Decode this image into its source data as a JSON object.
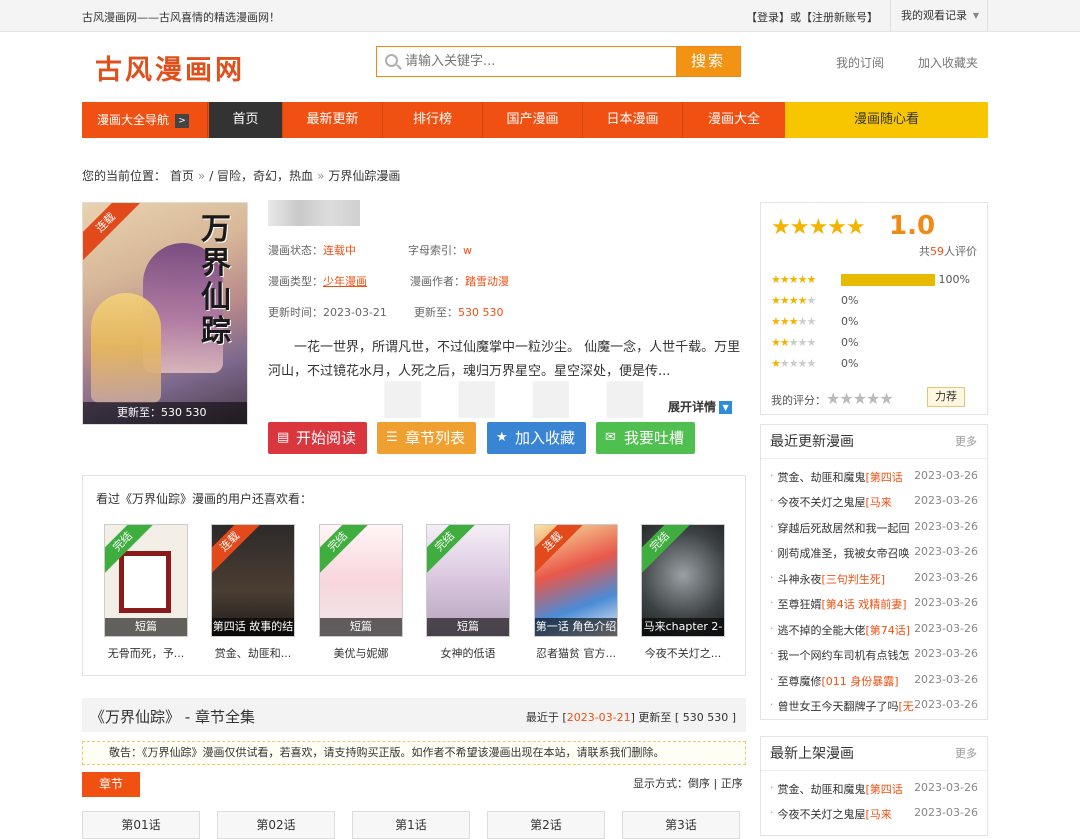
{
  "topbar": {
    "slogan": "古风漫画网——古风喜情的精选漫画网！",
    "login_label": "【登录】或【注册新账号】",
    "history_label": "我的观看记录"
  },
  "header": {
    "logo": "古风漫画网",
    "search_placeholder": "请输入关键字...",
    "search_button": "搜索",
    "link_subscribe": "我的订阅",
    "link_favorite": "加入收藏夹"
  },
  "nav": {
    "guide": "漫画大全导航",
    "items": [
      "首页",
      "最新更新",
      "排行榜",
      "国产漫画",
      "日本漫画",
      "漫画大全"
    ],
    "random": "漫画随心看"
  },
  "breadcrumb": {
    "prefix": "您的当前位置：",
    "home": "首页",
    "tags": "/ 冒险，奇幻，热血",
    "current": "万界仙踪漫画"
  },
  "comic": {
    "cover_title": "万界仙踪",
    "cover_status": "连载",
    "cover_update": "更新至：530 530",
    "status_label": "漫画状态：",
    "status_value": "连载中",
    "index_label": "字母索引：",
    "index_value": "w",
    "type_label": "漫画类型：",
    "type_value": "少年漫画",
    "author_label": "漫画作者：",
    "author_value": "踏雪动漫",
    "time_label": "更新时间：",
    "time_value": "2023-03-21",
    "upto_label": "更新至：",
    "upto_value": "530 530",
    "description": "一花一世界，所谓凡世，不过仙魔掌中一粒沙尘。 仙魔一念，人世千载。万里河山，不过镜花水月，人死之后，魂归万界星空。星空深处，便是传...",
    "expand_label": "展开详情",
    "btn_read": "开始阅读",
    "btn_chapters": "章节列表",
    "btn_collect": "加入收藏",
    "btn_comment": "我要吐槽"
  },
  "rating": {
    "score": "1.0",
    "count_prefix": "共",
    "count": "59",
    "count_suffix": "人评价",
    "rows": [
      {
        "stars": 5,
        "percent": "100%",
        "fill": 1.0
      },
      {
        "stars": 4,
        "percent": "0%",
        "fill": 0
      },
      {
        "stars": 3,
        "percent": "0%",
        "fill": 0
      },
      {
        "stars": 2,
        "percent": "0%",
        "fill": 0
      },
      {
        "stars": 1,
        "percent": "0%",
        "fill": 0
      }
    ],
    "my_label": "我的评分：",
    "fight_label": "力荐"
  },
  "also": {
    "header": "看过《万界仙踪》漫画的用户还喜欢看：",
    "items": [
      {
        "badge": "完结",
        "caption": "短篇",
        "title": "无骨而死，予...",
        "color": "green"
      },
      {
        "badge": "连载",
        "caption": "第四话 故事的结",
        "title": "赏金、劫匪和...",
        "color": "red"
      },
      {
        "badge": "完结",
        "caption": "短篇",
        "title": "美优与妮娜",
        "color": "green"
      },
      {
        "badge": "完结",
        "caption": "短篇",
        "title": "女神的低语",
        "color": "green"
      },
      {
        "badge": "连载",
        "caption": "第一话 角色介绍",
        "title": "忍者猫贫 官方...",
        "color": "red"
      },
      {
        "badge": "完结",
        "caption": "马来chapter 2-",
        "title": "今夜不关灯之...",
        "color": "green"
      }
    ]
  },
  "chapters": {
    "title": "《万界仙踪》 - 章节全集",
    "update_prefix": "最近于 [",
    "update_date": "2023-03-21",
    "update_suffix": "] 更新至 [ 530 530 ]",
    "notice": "敬告：《万界仙踪》漫画仅供试看，若喜欢，请支持购买正版。如作者不希望该漫画出现在本站，请联系我们删除。",
    "tab": "章节",
    "order_label": "显示方式：",
    "order_desc": "倒序",
    "order_asc": "正序",
    "list": [
      "第01话",
      "第02话",
      "第1话",
      "第2话",
      "第3话"
    ]
  },
  "recent": {
    "title": "最近更新漫画",
    "more": "更多",
    "items": [
      {
        "name": "赏金、劫匪和魔鬼",
        "ep": "[第四话",
        "date": "2023-03-26"
      },
      {
        "name": "今夜不关灯之鬼屋",
        "ep": "[马来",
        "date": "2023-03-26"
      },
      {
        "name": "穿越后死敌居然和我一起回",
        "ep": "",
        "date": "2023-03-26"
      },
      {
        "name": "刚苟成准圣，我被女帝召唤",
        "ep": "",
        "date": "2023-03-26"
      },
      {
        "name": "斗神永夜",
        "ep": "[三句判生死]",
        "date": "2023-03-26"
      },
      {
        "name": "至尊狂婿",
        "ep": "[第4话 戏精前妻]",
        "date": "2023-03-26"
      },
      {
        "name": "逃不掉的全能大佬",
        "ep": "[第74话]",
        "date": "2023-03-26"
      },
      {
        "name": "我一个网约车司机有点钱怎",
        "ep": "",
        "date": "2023-03-26"
      },
      {
        "name": "至尊魔修",
        "ep": "[011 身份暴露]",
        "date": "2023-03-26"
      },
      {
        "name": "曾世女王今天翻牌子了吗",
        "ep": "[无",
        "date": "2023-03-26"
      }
    ]
  },
  "newest": {
    "title": "最新上架漫画",
    "more": "更多",
    "items": [
      {
        "name": "赏金、劫匪和魔鬼",
        "ep": "[第四话",
        "date": "2023-03-26"
      },
      {
        "name": "今夜不关灯之鬼屋",
        "ep": "[马来",
        "date": "2023-03-26"
      }
    ]
  },
  "colors": {
    "accent": "#f05012",
    "search": "#f39314",
    "yellow": "#f7c600",
    "btn_read": "#d9363e",
    "btn_chapters": "#f0a030",
    "btn_collect": "#3a84d4",
    "btn_comment": "#4fbf4f"
  }
}
